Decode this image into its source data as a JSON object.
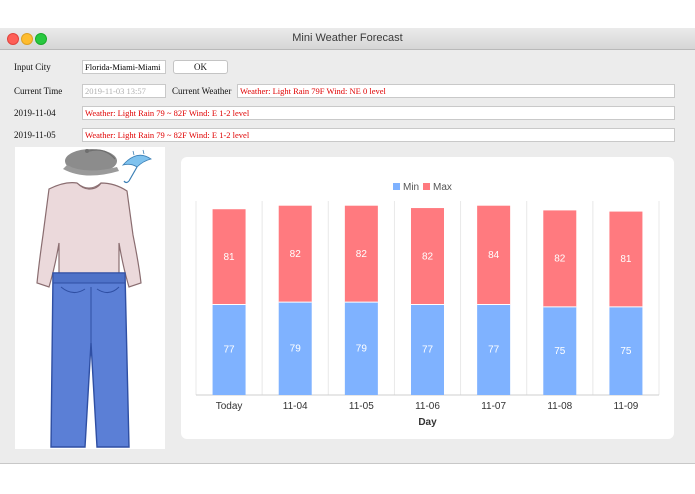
{
  "window": {
    "title": "Mini Weather Forecast"
  },
  "form": {
    "input_city_label": "Input City",
    "city_value": "Florida-Miami-Miami",
    "ok_label": "OK",
    "current_time_label": "Current Time",
    "current_time_value": "2019-11-03 13:57",
    "current_weather_label": "Current Weather",
    "current_weather_value": "Weather: Light Rain  79F  Wind: NE  0 level",
    "forecast": [
      {
        "date": "2019-11-04",
        "text": "Weather: Light Rain  79 ~ 82F  Wind: E 1-2 level"
      },
      {
        "date": "2019-11-05",
        "text": "Weather: Light Rain  79 ~ 82F  Wind: E 1-2 level"
      }
    ]
  },
  "icons": {
    "cap": "cap-icon",
    "umbrella": "umbrella-icon",
    "shirt": "long-sleeve-shirt-icon",
    "jeans": "jeans-icon"
  },
  "colors": {
    "min": "#7fb2ff",
    "max": "#ff7a7f",
    "error_text": "#e00000"
  },
  "chart_data": {
    "type": "bar",
    "stacked": true,
    "categories": [
      "Today",
      "11-04",
      "11-05",
      "11-06",
      "11-07",
      "11-08",
      "11-09"
    ],
    "series": [
      {
        "name": "Min",
        "values": [
          77,
          79,
          79,
          77,
          77,
          75,
          75
        ]
      },
      {
        "name": "Max",
        "values": [
          81,
          82,
          82,
          82,
          84,
          82,
          81
        ]
      }
    ],
    "xlabel": "Day",
    "ylabel": "",
    "ylim": [
      0,
      165
    ],
    "legend": "top",
    "grid": "vertical"
  }
}
